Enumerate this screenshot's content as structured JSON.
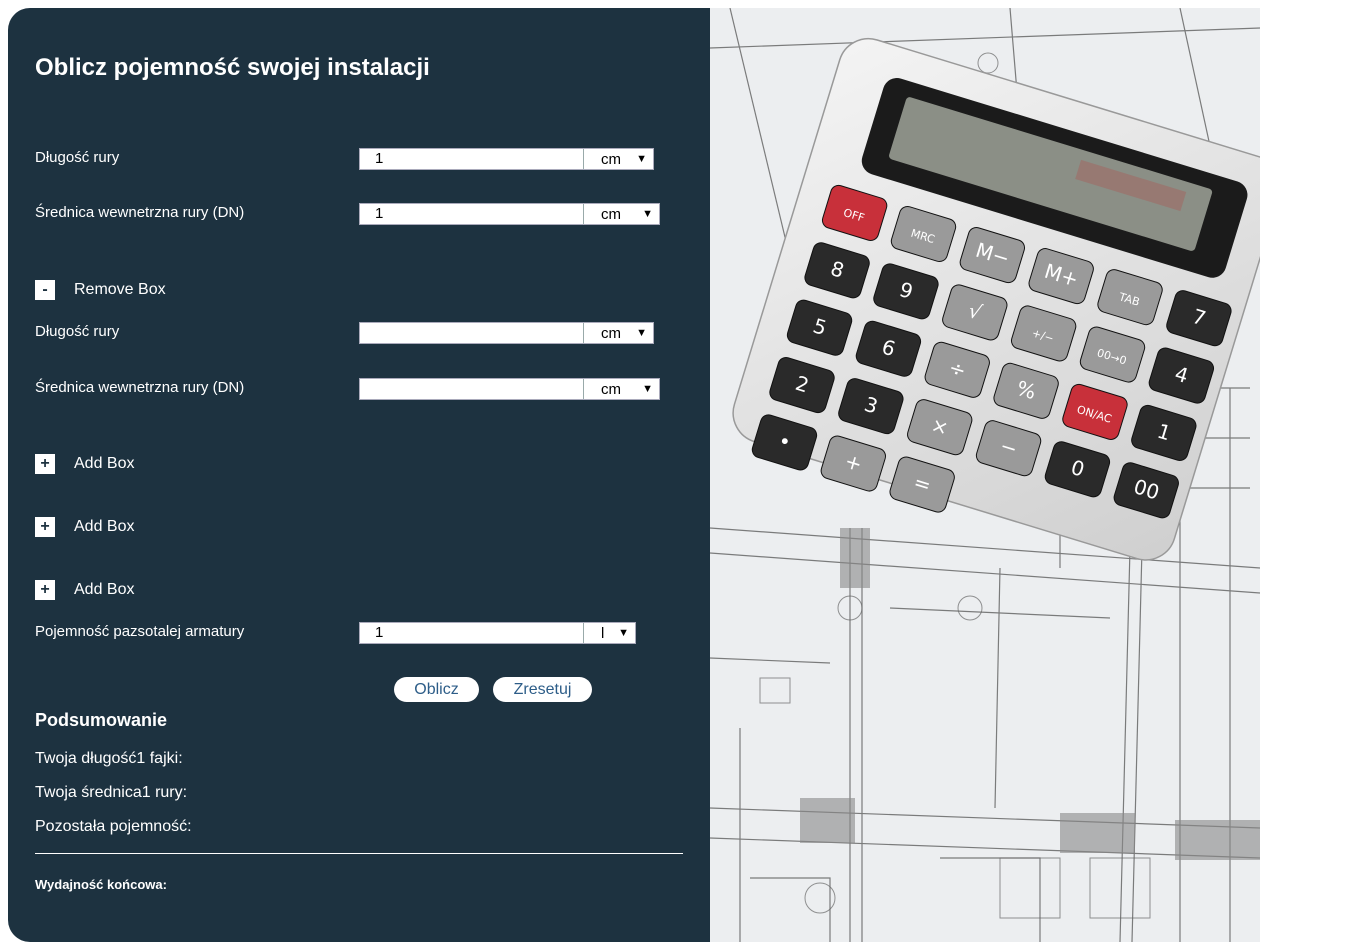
{
  "title": "Oblicz pojemność swojej instalacji",
  "box1": {
    "length_label": "Długość rury",
    "length_value": "1",
    "length_unit": "cm",
    "diameter_label": "Średnica wewnetrzna rury (DN)",
    "diameter_value": "1",
    "diameter_unit": "cm"
  },
  "remove_box": {
    "icon": "-",
    "label": "Remove Box"
  },
  "box2": {
    "length_label": "Długość rury",
    "length_value": "",
    "length_unit": "cm",
    "diameter_label": "Średnica wewnetrzna rury (DN)",
    "diameter_value": "",
    "diameter_unit": "cm"
  },
  "add_boxes": [
    {
      "icon": "+",
      "label": "Add Box"
    },
    {
      "icon": "+",
      "label": "Add Box"
    },
    {
      "icon": "+",
      "label": "Add Box"
    }
  ],
  "fittings": {
    "label": "Pojemność pazsotalej armatury",
    "value": "1",
    "unit": "l"
  },
  "buttons": {
    "calculate": "Oblicz",
    "reset": "Zresetuj"
  },
  "summary": {
    "heading": "Podsumowanie",
    "length": "Twoja długość1 fajki:",
    "diameter": "Twoja średnica1 rury:",
    "remaining": "Pozostała pojemność:",
    "final": "Wydajność końcowa:"
  },
  "icons": {
    "dropdown": "chevron-down-icon"
  },
  "calculator": {
    "keys": [
      "OFF",
      "MRC",
      "M−",
      "M+",
      "TAB",
      "7",
      "8",
      "9",
      "√",
      "+/−",
      "00→0",
      "4",
      "5",
      "6",
      "÷",
      "%",
      "ON/AC",
      "1",
      "2",
      "3",
      "×",
      "−",
      "0",
      "00",
      "•",
      "+",
      "="
    ]
  },
  "colors": {
    "panel": "#1d3240",
    "button_text": "#2d5d88",
    "photo": "#e9ebee"
  }
}
